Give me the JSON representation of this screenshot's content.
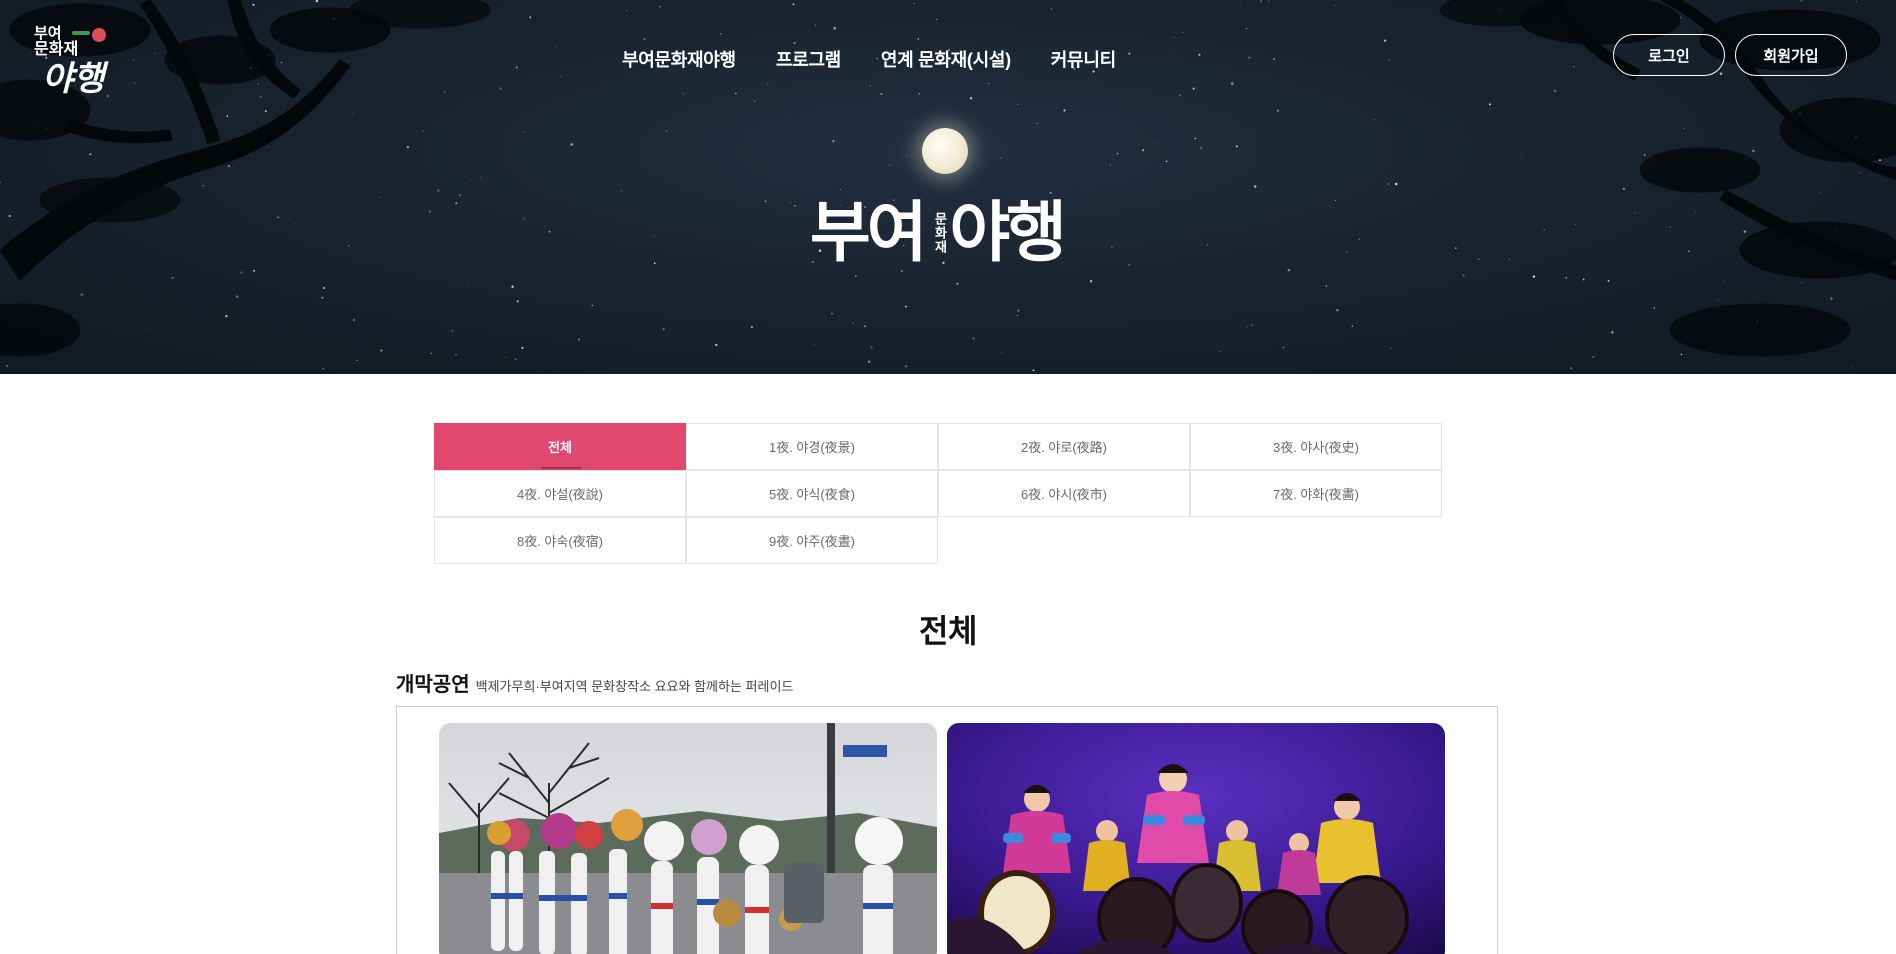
{
  "brand": {
    "logo_line1": "부여",
    "logo_line2": "문화재",
    "logo_line3": "야행",
    "hero_title_left": "부여",
    "hero_title_middle": "문화재",
    "hero_title_right": "야행"
  },
  "nav": {
    "items": [
      {
        "label": "부여문화재야행"
      },
      {
        "label": "프로그램"
      },
      {
        "label": "연계 문화재(시설)"
      },
      {
        "label": "커뮤니티"
      }
    ]
  },
  "auth": {
    "login": "로그인",
    "signup": "회원가입"
  },
  "tabs": [
    {
      "label": "전체",
      "active": true
    },
    {
      "label": "1夜. 야경(夜景)"
    },
    {
      "label": "2夜. 야로(夜路)"
    },
    {
      "label": "3夜. 야사(夜史)"
    },
    {
      "label": "4夜. 야설(夜說)"
    },
    {
      "label": "5夜. 야식(夜食)"
    },
    {
      "label": "6夜. 야시(夜市)"
    },
    {
      "label": "7夜. 야화(夜畵)"
    },
    {
      "label": "8夜. 야숙(夜宿)"
    },
    {
      "label": "9夜. 야주(夜晝)"
    }
  ],
  "section": {
    "title": "전체"
  },
  "category": {
    "title": "개막공연",
    "description": "백제가무희·부여지역 문화창작소 요요와 함께하는 퍼레이드"
  },
  "colors": {
    "accent": "#e04870",
    "hero_bg": "#19232f"
  },
  "photos": [
    {
      "subject": "parade-photo"
    },
    {
      "subject": "drum-dance-photo"
    }
  ]
}
